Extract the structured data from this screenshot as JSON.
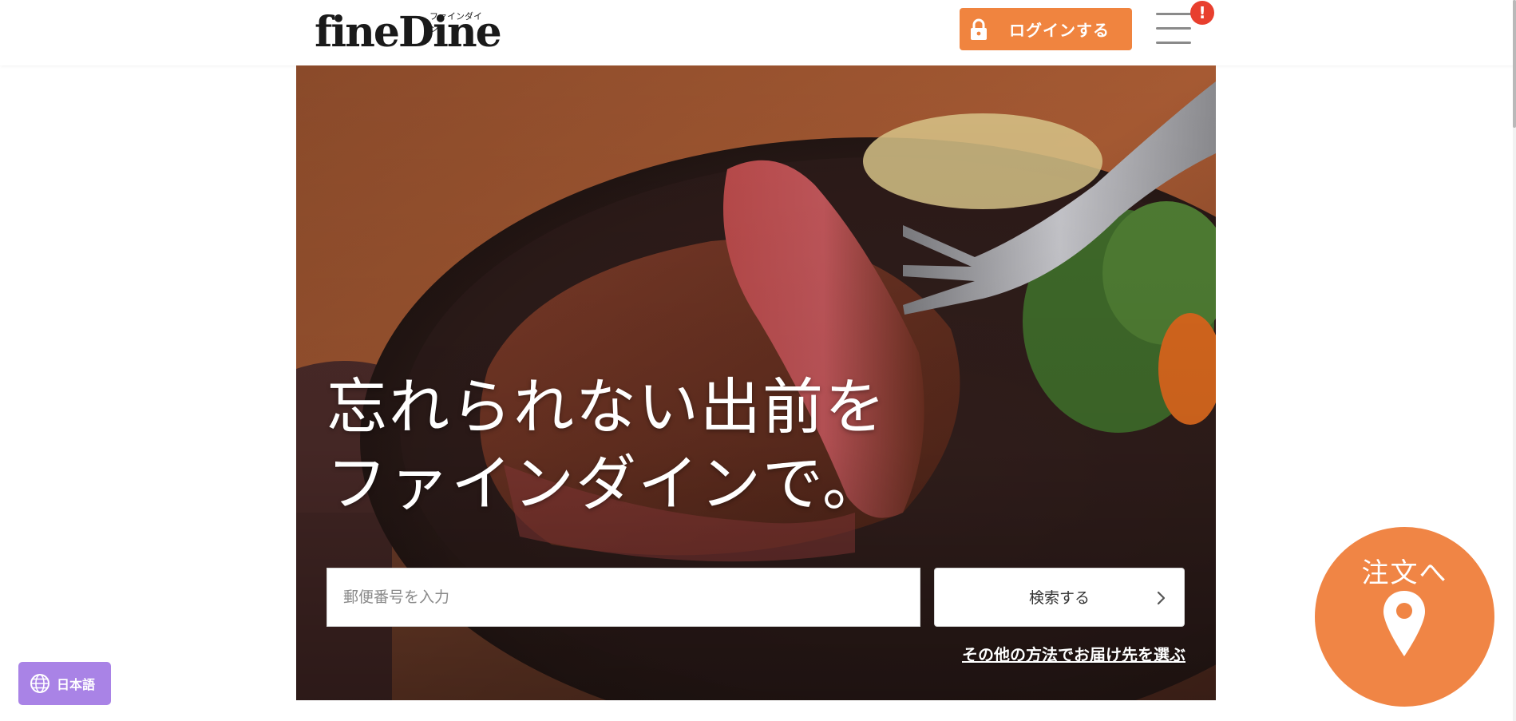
{
  "header": {
    "logo_text": "fineDine",
    "logo_kana": "ファインダイン",
    "login_label": "ログインする",
    "notification_badge": "!",
    "lock_icon": "lock-icon",
    "menu_icon": "hamburger-menu-icon"
  },
  "hero": {
    "headline_line1": "忘れられない出前を",
    "headline_line2": "ファインダインで。",
    "postal_placeholder": "郵便番号を入力",
    "postal_value": "",
    "search_label": "検索する",
    "other_method_link": "その他の方法でお届け先を選ぶ"
  },
  "order_fab": {
    "label": "注文へ",
    "icon": "map-pin-icon"
  },
  "language": {
    "label": "日本語",
    "icon": "globe-icon"
  },
  "colors": {
    "accent": "#f0843f",
    "badge": "#e83f2e",
    "language_button": "#a983e6"
  }
}
